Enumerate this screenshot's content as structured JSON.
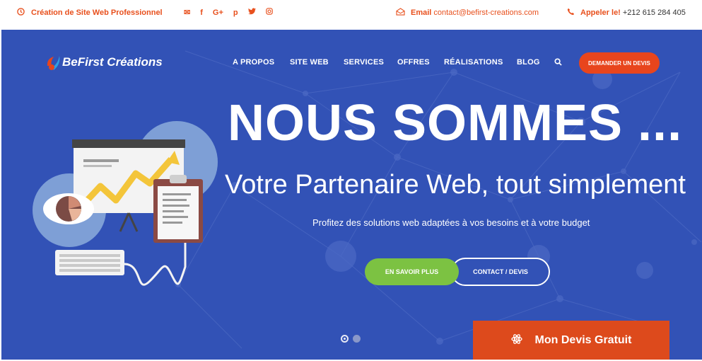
{
  "topbar": {
    "tagline": "Création de Site Web Professionnel",
    "social_icons": [
      "envelope-icon",
      "facebook-icon",
      "google-plus-icon",
      "pinterest-icon",
      "twitter-icon",
      "instagram-icon"
    ],
    "social_glyphs": [
      "✉",
      "f",
      "G+",
      "p",
      "🐦",
      "◎"
    ],
    "email_label": "Email",
    "email_value": "contact@befirst-creations.com",
    "phone_label": "Appeler le!",
    "phone_value": "+212 615 284 405"
  },
  "logo": {
    "text": "BeFirst Créations"
  },
  "nav": {
    "items": [
      "A PROPOS",
      "SITE WEB",
      "SERVICES",
      "OFFRES",
      "RÉALISATIONS",
      "BLOG"
    ],
    "cta": "DEMANDER UN DEVIS"
  },
  "hero": {
    "headline": "NOUS SOMMES ...",
    "subheadline": "Votre Partenaire Web, tout simplement",
    "tagline": "Profitez des solutions web adaptées à vos besoins et à votre budget",
    "primary_button": "EN SAVOIR PLUS",
    "secondary_button": "CONTACT / DEVIS",
    "slides_count": 2,
    "active_slide": 1
  },
  "floating_cta": {
    "label": "Mon Devis Gratuit"
  },
  "colors": {
    "accent": "#e8501d",
    "hero_bg": "#3252b6",
    "green": "#7cc242",
    "cta_orange": "#dd4a1c"
  }
}
